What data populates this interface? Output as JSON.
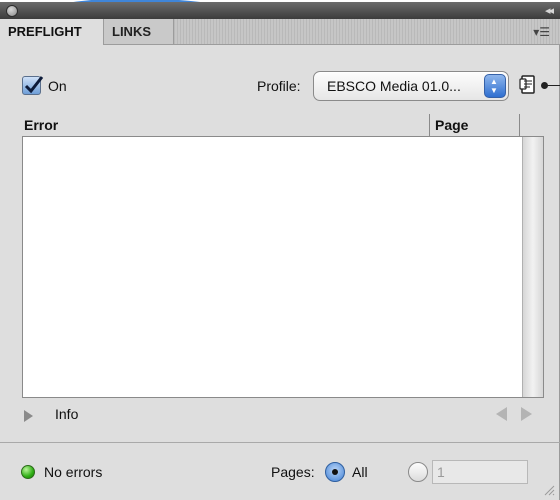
{
  "tabs": [
    {
      "label": "PREFLIGHT"
    },
    {
      "label": "LINKS"
    }
  ],
  "controls": {
    "on_label": "On",
    "on_checked": true,
    "profile_label": "Profile:",
    "profile_value": "EBSCO Media 01.0..."
  },
  "table": {
    "columns": [
      "Error",
      "Page"
    ]
  },
  "info_label": "Info",
  "footer": {
    "status_text": "No errors",
    "status_color": "#2fae15",
    "pages_label": "Pages:",
    "all_label": "All",
    "page_range_value": "1"
  },
  "icons": {
    "close": "close-icon",
    "collapse": "collapse-icon",
    "panel_menu": "panel-menu-icon",
    "profile_menu": "profile-menu-icon",
    "info_toggle": "info-toggle-icon",
    "prev": "previous-arrow-icon",
    "next": "next-arrow-icon"
  },
  "colors": {
    "accent_blue": "#3f80d6",
    "title_bar": "#4a4a4a",
    "panel_bg": "#dedede"
  }
}
